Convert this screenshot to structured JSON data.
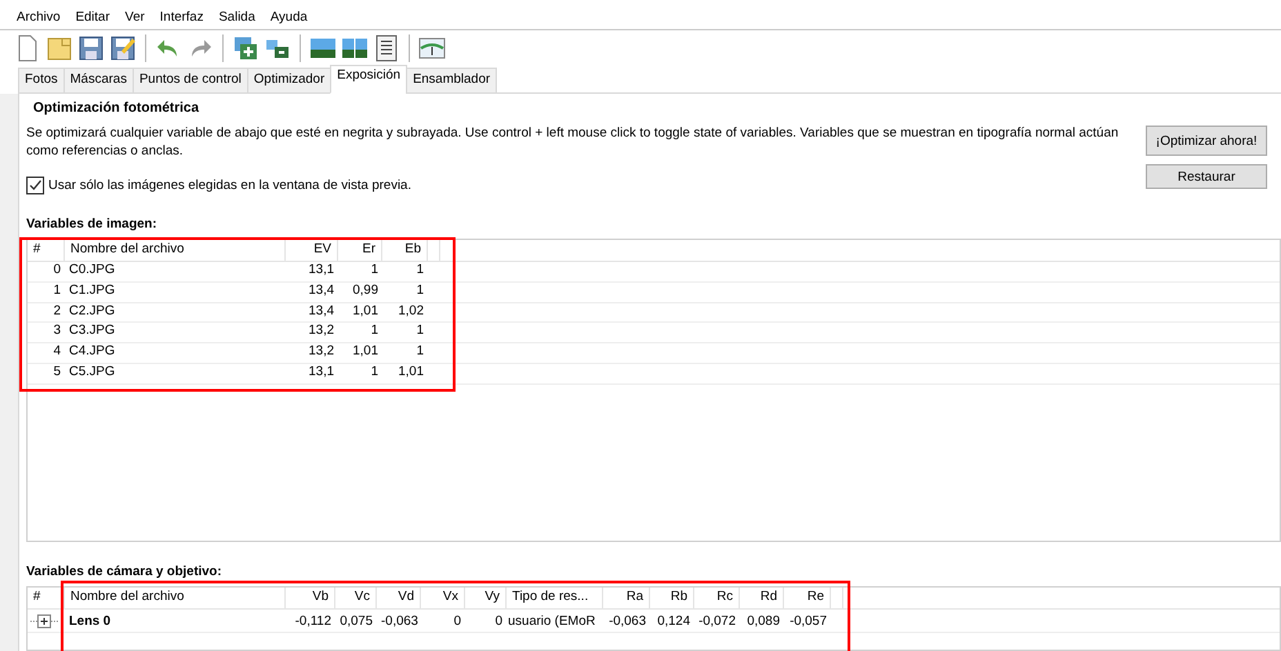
{
  "menu": [
    "Archivo",
    "Editar",
    "Ver",
    "Interfaz",
    "Salida",
    "Ayuda"
  ],
  "tabs": [
    {
      "label": "Fotos",
      "selected": false
    },
    {
      "label": "Máscaras",
      "selected": false
    },
    {
      "label": "Puntos de control",
      "selected": false
    },
    {
      "label": "Optimizador",
      "selected": false
    },
    {
      "label": "Exposición",
      "selected": true
    },
    {
      "label": "Ensamblador",
      "selected": false
    }
  ],
  "section_title": "Optimización fotométrica",
  "description": "Se optimizará cualquier variable de abajo que esté en negrita y subrayada. Use control + left mouse click to toggle state of variables. Variables que se muestran en tipografía normal actúan como referencias o anclas.",
  "buttons": [
    "¡Optimizar ahora!",
    "Restaurar"
  ],
  "checkbox": {
    "label": "Usar sólo las imágenes elegidas en la ventana de vista previa.",
    "checked": true
  },
  "image_variables": {
    "title": "Variables de imagen:",
    "highlighted": true,
    "columns": [
      "#",
      "Nombre del archivo",
      "EV",
      "Er",
      "Eb"
    ],
    "rows": [
      [
        "0",
        "C0.JPG",
        "13,1",
        "1",
        "1"
      ],
      [
        "1",
        "C1.JPG",
        "13,4",
        "0,99",
        "1"
      ],
      [
        "2",
        "C2.JPG",
        "13,4",
        "1,01",
        "1,02"
      ],
      [
        "3",
        "C3.JPG",
        "13,2",
        "1",
        "1"
      ],
      [
        "4",
        "C4.JPG",
        "13,2",
        "1,01",
        "1"
      ],
      [
        "5",
        "C5.JPG",
        "13,1",
        "1",
        "1,01"
      ]
    ]
  },
  "camera_variables": {
    "title": "Variables de cámara y objetivo:",
    "highlighted": true,
    "columns": [
      "#",
      "Nombre del archivo",
      "Vb",
      "Vc",
      "Vd",
      "Vx",
      "Vy",
      "Tipo de res...",
      "Ra",
      "Rb",
      "Rc",
      "Rd",
      "Re"
    ],
    "rows": [
      {
        "expanded": false,
        "cells": [
          "",
          "Lens 0",
          "-0,112",
          "0,075",
          "-0,063",
          "0",
          "0",
          "usuario (EMoR",
          "-0,063",
          "0,124",
          "-0,072",
          "0,089",
          "-0,057"
        ]
      }
    ]
  }
}
